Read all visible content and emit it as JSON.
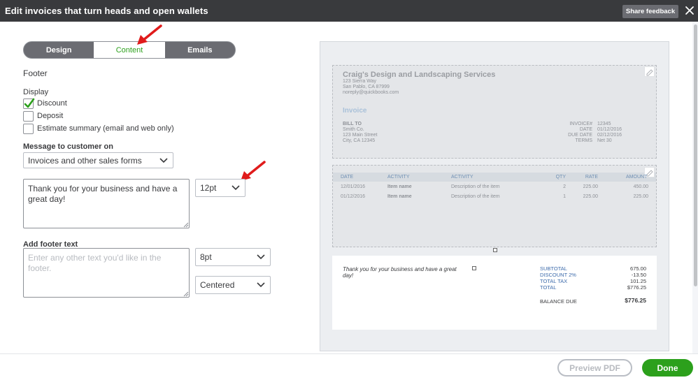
{
  "titlebar": {
    "title": "Edit invoices that turn heads and open wallets",
    "share_label": "Share feedback"
  },
  "tabs": [
    {
      "label": "Design"
    },
    {
      "label": "Content"
    },
    {
      "label": "Emails"
    }
  ],
  "section_title": "Footer",
  "display": {
    "label": "Display",
    "options": [
      {
        "label": "Discount",
        "checked": true
      },
      {
        "label": "Deposit",
        "checked": false
      },
      {
        "label": "Estimate summary (email and web only)",
        "checked": false
      }
    ]
  },
  "message": {
    "label": "Message to customer on",
    "form_select": "Invoices and other sales forms",
    "text": "Thank you for your business and have a great day!",
    "font_size": "12pt"
  },
  "footer_text": {
    "label": "Add footer text",
    "placeholder": "Enter any other text you'd like in the footer.",
    "font_size": "8pt",
    "alignment": "Centered"
  },
  "preview": {
    "company": {
      "name": "Craig's Design and Landscaping Services",
      "address1": "123 Sierra Way",
      "address2": "San Pablo, CA 87999",
      "email": "noreply@quickbooks.com"
    },
    "invoice_label": "Invoice",
    "bill_to": {
      "label": "BILL TO",
      "name": "Smith Co.",
      "address1": "123 Main Street",
      "address2": "City, CA 12345"
    },
    "meta": [
      {
        "label": "INVOICE#",
        "value": "12345"
      },
      {
        "label": "DATE",
        "value": "01/12/2016"
      },
      {
        "label": "DUE DATE",
        "value": "02/12/2016"
      },
      {
        "label": "TERMS",
        "value": "Net 30"
      }
    ],
    "table": {
      "headers": [
        "DATE",
        "ACTIVITY",
        "ACTIVITY",
        "QTY",
        "RATE",
        "AMOUNT"
      ],
      "rows": [
        [
          "12/01/2016",
          "Item name",
          "Description of the item",
          "2",
          "225.00",
          "450.00"
        ],
        [
          "01/12/2016",
          "Item name",
          "Description of the item",
          "1",
          "225.00",
          "225.00"
        ]
      ]
    },
    "footer_message": "Thank you for your business and have a great day!",
    "totals": [
      {
        "label": "SUBTOTAL",
        "value": "675.00"
      },
      {
        "label": "DISCOUNT 2%",
        "value": "-13.50"
      },
      {
        "label": "TOTAL TAX",
        "value": "101.25"
      },
      {
        "label": "TOTAL",
        "value": "$776.25"
      }
    ],
    "balance_label": "BALANCE DUE",
    "balance_value": "$776.25"
  },
  "actions": {
    "preview_pdf": "Preview PDF",
    "done": "Done"
  },
  "colors": {
    "accent": "#2ca01c",
    "titlebar": "#393a3d",
    "annotation_arrow": "#e01b1b"
  }
}
